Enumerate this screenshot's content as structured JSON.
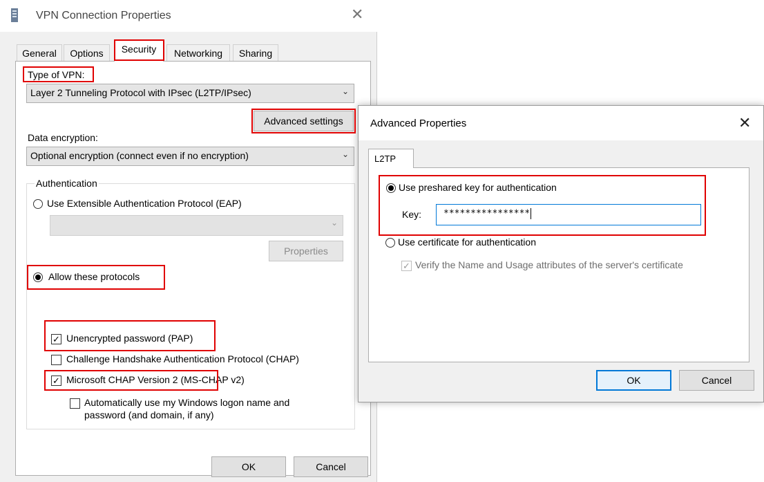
{
  "vpn_dialog": {
    "title": "VPN Connection Properties",
    "close_glyph": "✕",
    "tabs": [
      {
        "label": "General"
      },
      {
        "label": "Options"
      },
      {
        "label": "Security"
      },
      {
        "label": "Networking"
      },
      {
        "label": "Sharing"
      }
    ],
    "active_tab": "Security",
    "type_of_vpn_label": "Type of VPN:",
    "type_of_vpn_value": "Layer 2 Tunneling Protocol with IPsec (L2TP/IPsec)",
    "advanced_settings_label": "Advanced settings",
    "data_encryption_label": "Data encryption:",
    "data_encryption_value": "Optional encryption (connect even if no encryption)",
    "authentication_label": "Authentication",
    "use_eap_label": "Use Extensible Authentication Protocol (EAP)",
    "eap_value": "",
    "properties_label": "Properties",
    "allow_protocols_label": "Allow these protocols",
    "pap_label": "Unencrypted password (PAP)",
    "chap_label": "Challenge Handshake Authentication Protocol (CHAP)",
    "mschap_label": "Microsoft CHAP Version 2 (MS-CHAP v2)",
    "auto_logon_label_1": "Automatically use my Windows logon name and",
    "auto_logon_label_2": "password (and domain, if any)",
    "ok_label": "OK",
    "cancel_label": "Cancel",
    "states": {
      "use_eap": false,
      "allow_protocols": true,
      "pap": true,
      "chap": false,
      "mschap": true,
      "auto_logon": false
    }
  },
  "advanced_dialog": {
    "title": "Advanced Properties",
    "close_glyph": "✕",
    "tab_label": "L2TP",
    "preshared_label": "Use preshared key for authentication",
    "key_label": "Key:",
    "key_value": "****************",
    "certificate_label": "Use certificate for authentication",
    "verify_label": "Verify the Name and Usage attributes of the server's certificate",
    "ok_label": "OK",
    "cancel_label": "Cancel",
    "states": {
      "preshared": true,
      "certificate": false,
      "verify": true
    }
  },
  "colors": {
    "highlight": "#e00000",
    "focus_blue": "#0078d7",
    "dialog_bg": "#f0f0f0"
  },
  "icons": {
    "vpn_title_icon": "vpn-network-icon",
    "close": "close-icon",
    "dropdown": "chevron-down-icon"
  }
}
